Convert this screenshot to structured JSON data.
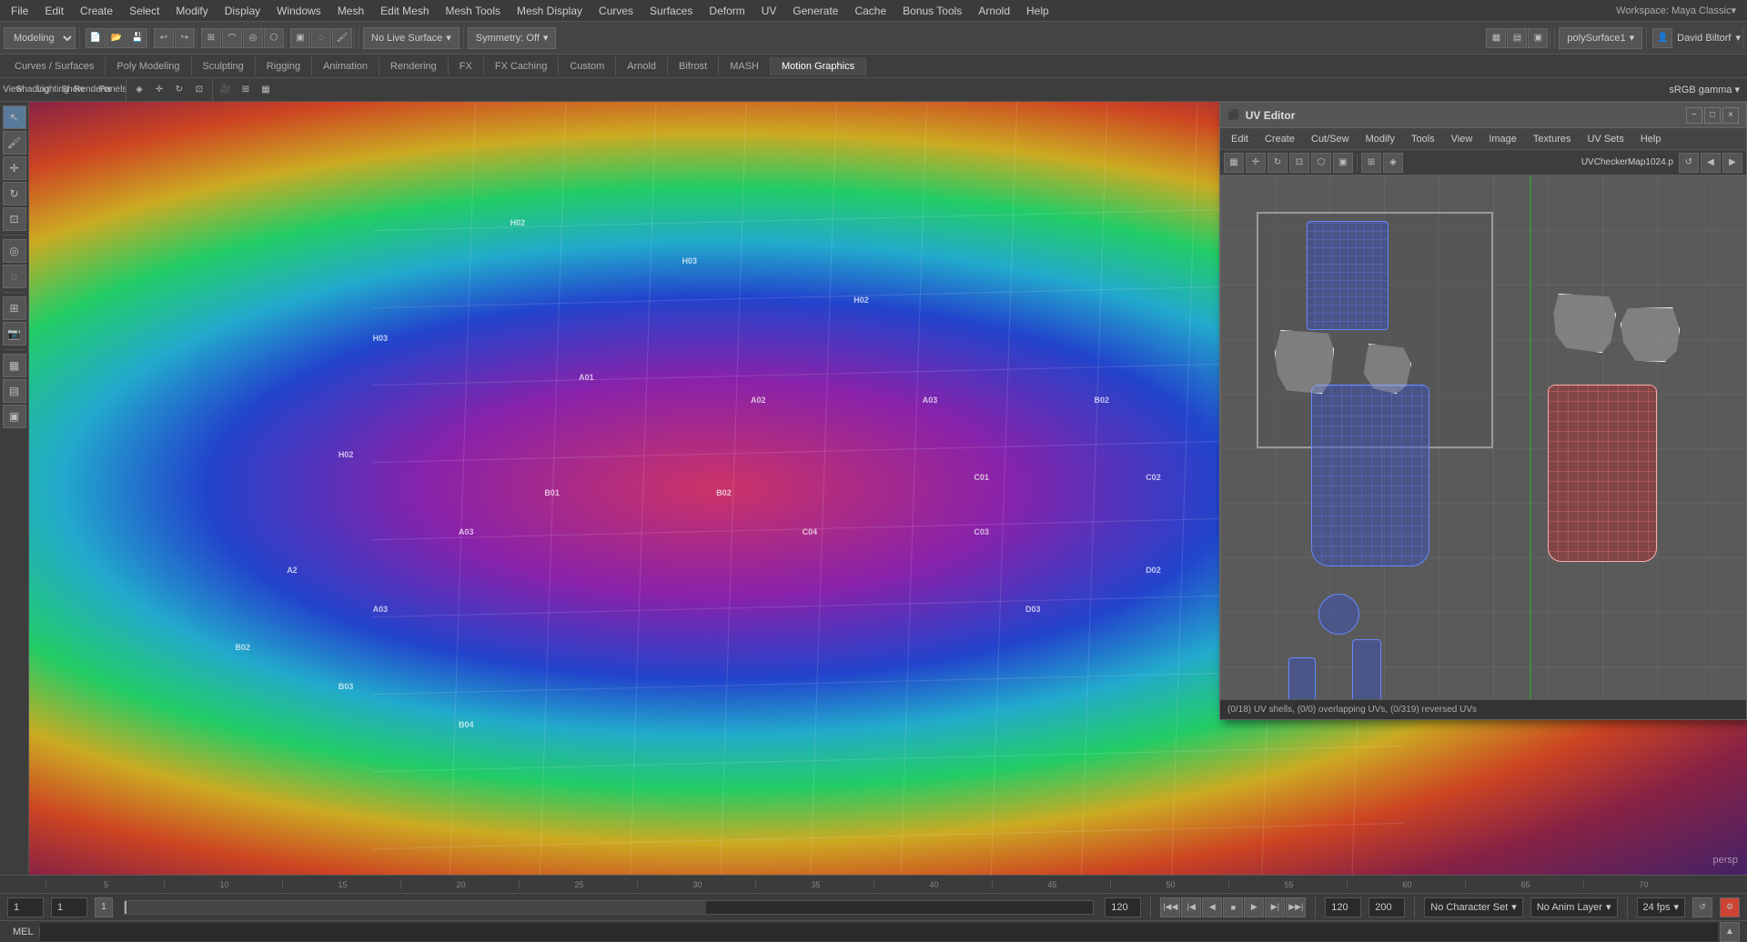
{
  "menubar": {
    "items": [
      "File",
      "Edit",
      "Create",
      "Select",
      "Modify",
      "Display",
      "Windows",
      "Mesh",
      "Edit Mesh",
      "Mesh Tools",
      "Mesh Display",
      "Curves",
      "Surfaces",
      "Deform",
      "UV",
      "Generate",
      "Cache",
      "Bonus Tools",
      "Arnold",
      "Help"
    ]
  },
  "toolbar": {
    "workspace_label": "Modeling",
    "no_live_surface": "No Live Surface",
    "symmetry": "Symmetry: Off",
    "poly_surface": "polySurface1",
    "user": "David Biltorf"
  },
  "tabs": {
    "items": [
      "Curves / Surfaces",
      "Poly Modeling",
      "Sculpting",
      "Rigging",
      "Animation",
      "Rendering",
      "FX",
      "FX Caching",
      "Custom",
      "Arnold",
      "Bifrost",
      "MASH",
      "Motion Graphics"
    ]
  },
  "viewport": {
    "label": "persp",
    "time_ticks": [
      "5",
      "10",
      "15",
      "20",
      "25",
      "30",
      "35",
      "40",
      "45",
      "50",
      "55",
      "60",
      "65",
      "70"
    ]
  },
  "uv_editor": {
    "title": "UV Editor",
    "menu_items": [
      "Edit",
      "Create",
      "Cut/Sew",
      "Modify",
      "Tools",
      "View",
      "Image",
      "Textures",
      "UV Sets",
      "Help"
    ],
    "texture_map": "UVCheckerMap1024.p",
    "status": "(0/18) UV shells, (0/0) overlapping UVs, (0/319) reversed UVs"
  },
  "status_bar": {
    "frame_start": "1",
    "frame_current": "1",
    "frame_playback": "1",
    "frame_end": "120",
    "frame_range_end": "120",
    "anim_end": "200",
    "no_character_set": "No Character Set",
    "no_anim_layer": "No Anim Layer",
    "fps": "24 fps"
  },
  "mel_bar": {
    "label": "MEL"
  },
  "icons": {
    "close": "×",
    "minimize": "−",
    "maximize": "□",
    "arrow_down": "▾",
    "arrow_right": "▸",
    "play": "▶",
    "play_back": "◀",
    "step_fwd": "▶|",
    "step_back": "|◀",
    "skip_end": "▶▶|",
    "skip_start": "|◀◀"
  }
}
